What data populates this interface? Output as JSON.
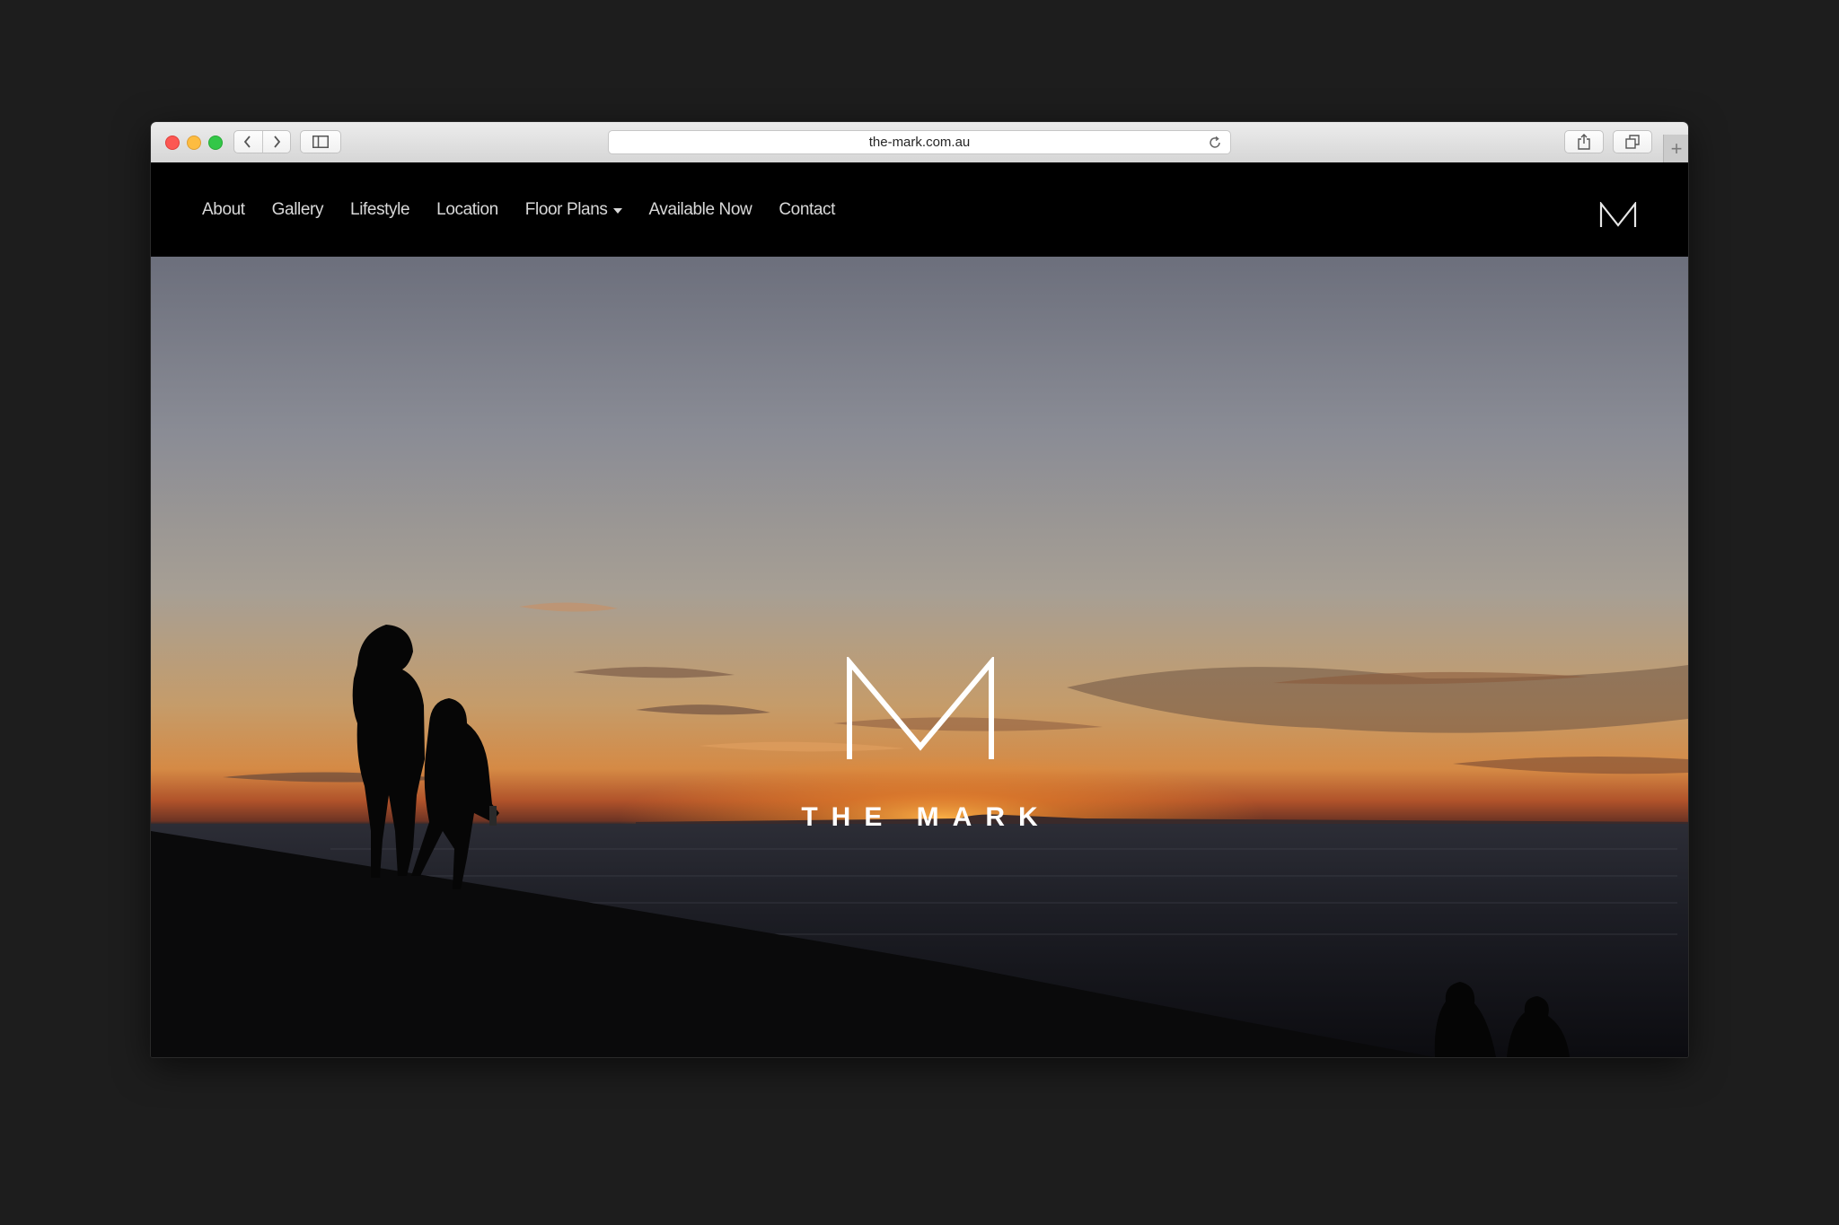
{
  "browser": {
    "url": "the-mark.com.au",
    "new_tab_glyph": "+"
  },
  "nav": {
    "items": [
      {
        "label": "About"
      },
      {
        "label": "Gallery"
      },
      {
        "label": "Lifestyle"
      },
      {
        "label": "Location"
      },
      {
        "label": "Floor Plans"
      },
      {
        "label": "Available Now"
      },
      {
        "label": "Contact"
      }
    ],
    "dropdown_item": "Floor Plans"
  },
  "hero": {
    "title": "THE MARK",
    "logo_icon": "m-monogram-icon"
  },
  "colors": {
    "page_background": "#1d1d1d",
    "nav_background": "#000000",
    "nav_text": "#d9d9d9",
    "sunset_accent": "#f08a2a"
  }
}
